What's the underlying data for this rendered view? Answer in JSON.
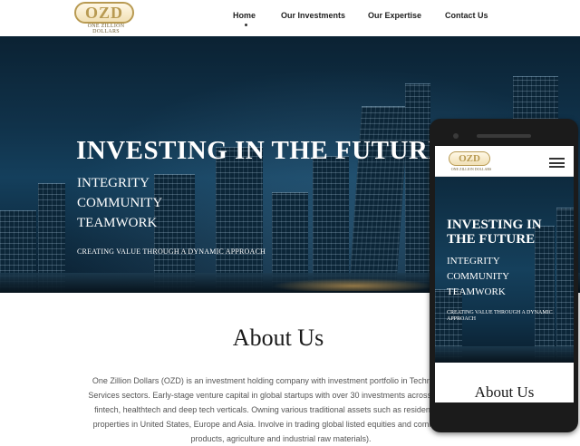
{
  "logo": {
    "mark": "OZD",
    "subtitle": "ONE ZILLION DOLLARS"
  },
  "nav": {
    "items": [
      {
        "label": "Home",
        "active": true
      },
      {
        "label": "Our Investments",
        "active": false
      },
      {
        "label": "Our Expertise",
        "active": false
      },
      {
        "label": "Contact Us",
        "active": false
      }
    ]
  },
  "hero": {
    "title": "INVESTING IN THE FUTURE",
    "values": [
      "INTEGRITY",
      "COMMUNITY",
      "TEAMWORK"
    ],
    "tagline": "CREATING VALUE THROUGH A DYNAMIC APPROACH"
  },
  "about": {
    "title": "About Us",
    "lines": [
      "One Zillion Dollars (OZD) is an investment holding company with investment portfolio in Technology, Rea",
      "Services sectors. Early-stage venture capital in global startups with over 30 investments across 7 countries",
      "fintech, healthtech and deep tech verticals. Owning various traditional assets such as residential, comm",
      "properties in United States, Europe and Asia. Involve in trading global listed equities and commodities (p",
      "products, agriculture and industrial raw materials)."
    ]
  },
  "mobile": {
    "logo_mark": "OZD",
    "logo_subtitle": "ONE ZILLION DOLLARS",
    "hero_title": "INVESTING IN THE FUTURE",
    "values": [
      "INTEGRITY",
      "COMMUNITY",
      "TEAMWORK"
    ],
    "tagline": "CREATING VALUE THROUGH A DYNAMIC APPROACH",
    "about_title": "About Us"
  },
  "colors": {
    "gold": "#b89a52",
    "hero_dark": "#0b2233",
    "hero_mid": "#143f5c"
  },
  "icons": {
    "menu": "hamburger-menu-icon",
    "active_indicator": "dot"
  }
}
